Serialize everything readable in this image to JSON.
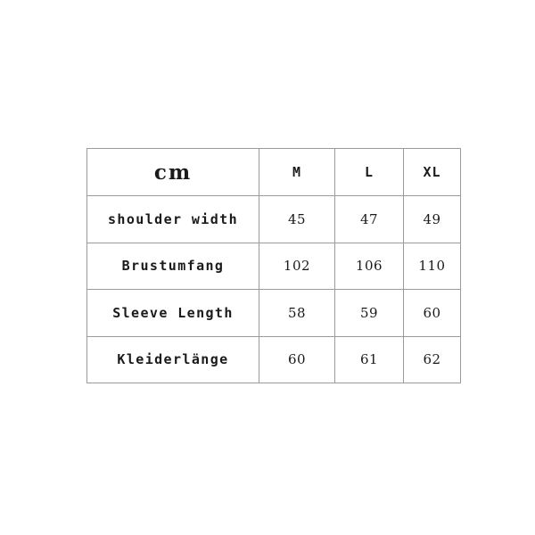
{
  "page": {
    "background_color": "#ffffff",
    "border_color": "#9b9b9b",
    "text_color": "#1a1a1a"
  },
  "chart_data": {
    "type": "table",
    "title": "cm",
    "unit": "cm",
    "columns": [
      "cm",
      "M",
      "L",
      "XL"
    ],
    "rows": [
      {
        "label": "shoulder width",
        "values": [
          "45",
          "47",
          "49"
        ]
      },
      {
        "label": "Brustumfang",
        "values": [
          "102",
          "106",
          "110"
        ]
      },
      {
        "label": "Sleeve Length",
        "values": [
          "58",
          "59",
          "60"
        ]
      },
      {
        "label": "Kleiderlänge",
        "values": [
          "60",
          "61",
          "62"
        ]
      }
    ]
  },
  "table": {
    "header": {
      "unit_label": "cm",
      "sizes": [
        "M",
        "L",
        "XL"
      ]
    },
    "rows": [
      {
        "label": "shoulder width",
        "m": "45",
        "l": "47",
        "xl": "49"
      },
      {
        "label": "Brustumfang",
        "m": "102",
        "l": "106",
        "xl": "110"
      },
      {
        "label": "Sleeve Length",
        "m": "58",
        "l": "59",
        "xl": "60"
      },
      {
        "label": "Kleiderlänge",
        "m": "60",
        "l": "61",
        "xl": "62"
      }
    ]
  }
}
